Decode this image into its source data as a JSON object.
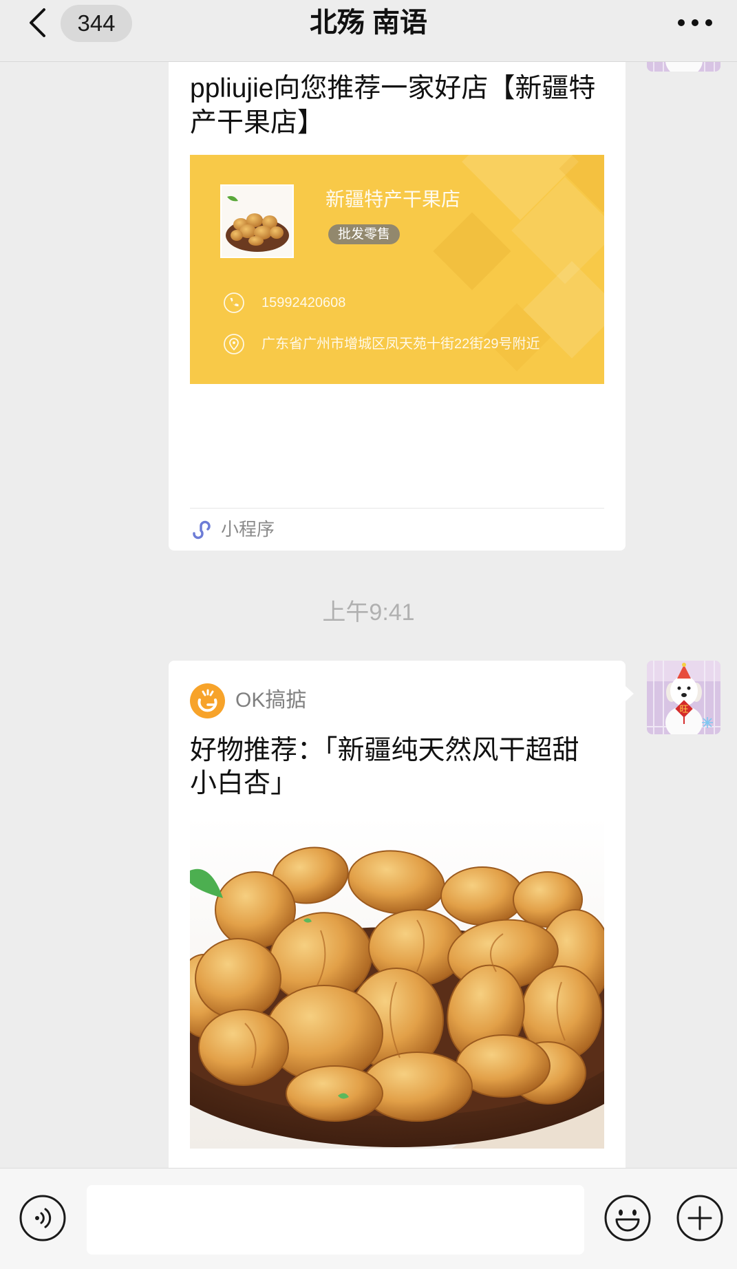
{
  "header": {
    "back_count": "344",
    "title": "北殇 南语"
  },
  "store_card": {
    "intro": "ppliujie向您推荐一家好店【新疆特产干果店】",
    "store_name": "新疆特产干果店",
    "tag": "批发零售",
    "phone": "15992420608",
    "address": "广东省广州市增城区凤天苑十街22街29号附近",
    "footer_label": "小程序"
  },
  "timestamp": "上午9:41",
  "article_card": {
    "source": "OK搞掂",
    "title": "好物推荐：「新疆纯天然风干超甜小白杏」"
  },
  "avatar": {
    "ornament_text": "旺"
  },
  "input_bar": {
    "value": ""
  },
  "colors": {
    "chat_background": "#ededed",
    "store_panel": "#f8c948",
    "source_logo": "#f7a32a",
    "timestamp_text": "#b0b0b0",
    "mini_program_icon": "#6d7cd6"
  },
  "icons": {
    "back": "chevron-left-icon",
    "more": "more-dots-icon",
    "phone": "phone-icon",
    "location": "location-pin-icon",
    "mini_program": "mini-program-icon",
    "voice": "voice-icon",
    "emoji": "emoji-icon",
    "plus": "plus-icon"
  }
}
